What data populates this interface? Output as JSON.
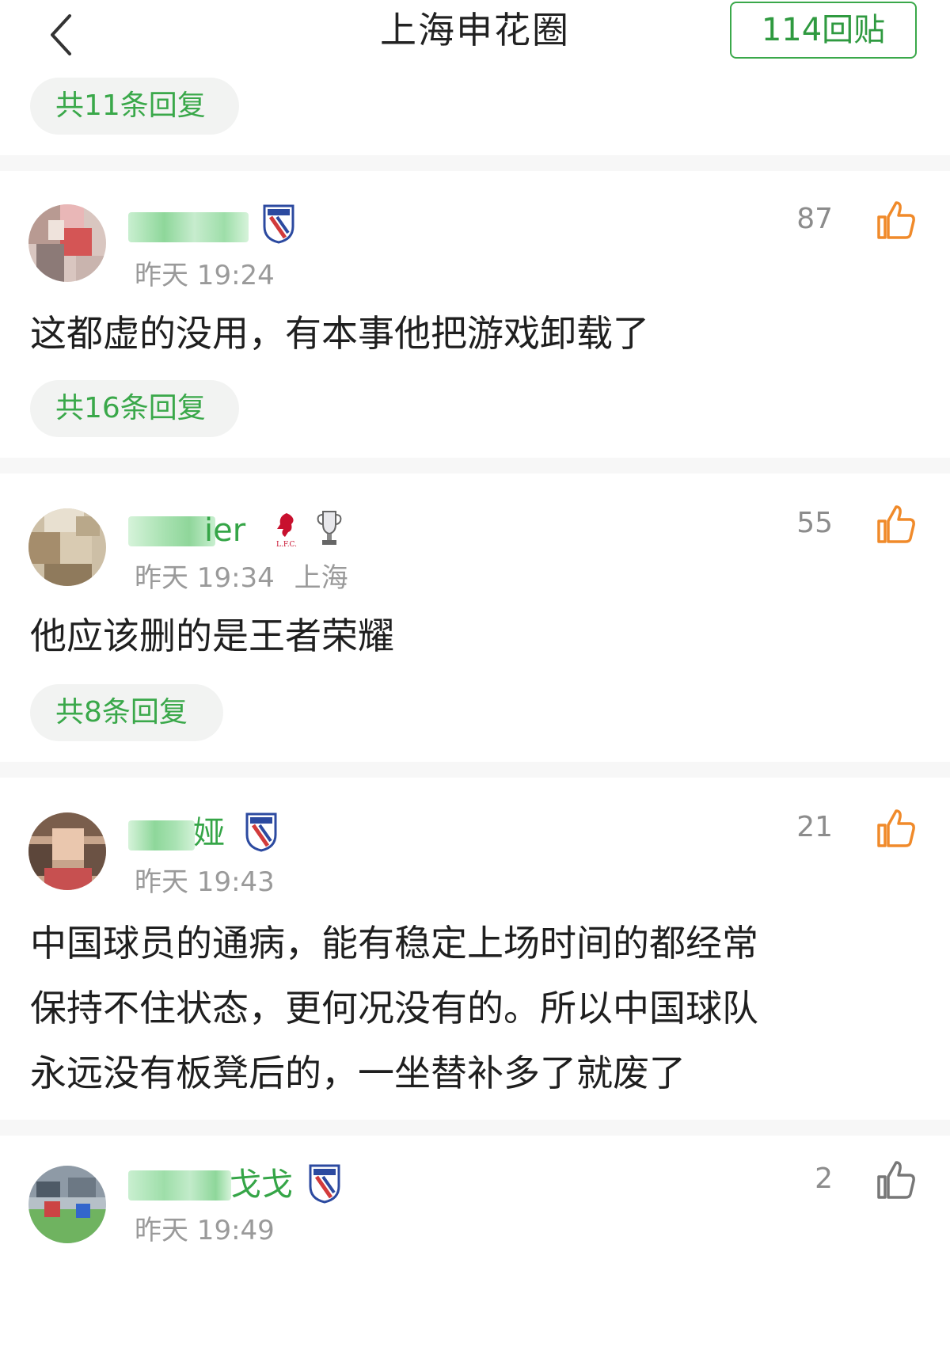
{
  "header": {
    "title": "上海申花圈",
    "reply_count": "114回贴"
  },
  "colors": {
    "accent": "#3aa84a",
    "like_orange": "#f08a2a",
    "muted": "#9a9a9a"
  },
  "top_reply_pill": "共11条回复",
  "comments": [
    {
      "name_suffix": "",
      "badges": [
        "shenhua-badge"
      ],
      "time": "昨天 19:24",
      "location": "",
      "likes": "87",
      "text": "这都虚的没用，有本事他把游戏卸载了",
      "replies": "共16条回复"
    },
    {
      "name_suffix": "ier",
      "badges": [
        "liverpool-badge",
        "premier-league-trophy-badge"
      ],
      "time": "昨天 19:34",
      "location": "上海",
      "likes": "55",
      "text": "他应该删的是王者荣耀",
      "replies": "共8条回复"
    },
    {
      "name_suffix": "娅",
      "badges": [
        "shenhua-badge"
      ],
      "time": "昨天 19:43",
      "location": "",
      "likes": "21",
      "text_lines": [
        "中国球员的通病，能有稳定上场时间的都经常",
        "保持不住状态，更何况没有的。所以中国球队",
        "永远没有板凳后的，一坐替补多了就废了"
      ]
    },
    {
      "name_suffix": "戈戈",
      "badges": [
        "shenhua-badge"
      ],
      "time": "昨天 19:49",
      "location": "",
      "likes": "2"
    }
  ]
}
